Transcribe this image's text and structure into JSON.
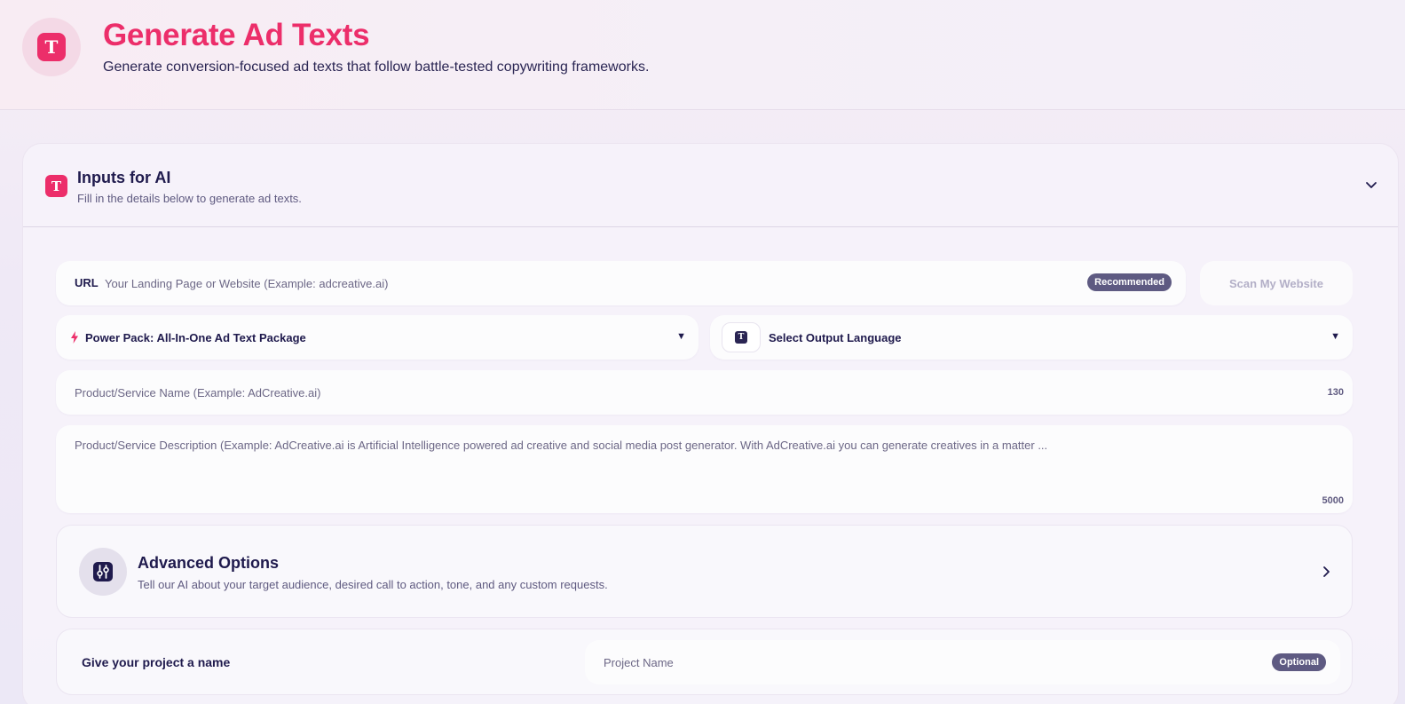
{
  "header": {
    "title": "Generate Ad Texts",
    "subtitle": "Generate conversion-focused ad texts that follow battle-tested copywriting frameworks.",
    "logo_icon": "t-logo-icon"
  },
  "inputs_card": {
    "title": "Inputs for AI",
    "subtitle": "Fill in the details below to generate ad texts.",
    "collapse_icon": "chevron-down-icon"
  },
  "url_field": {
    "label": "URL",
    "value": "",
    "placeholder": "Your Landing Page or Website (Example: adcreative.ai)",
    "badge": "Recommended"
  },
  "scan_button": {
    "label": "Scan My Website"
  },
  "package_select": {
    "icon": "lightning-bolt-icon",
    "selected": "Power Pack: All-In-One Ad Text Package"
  },
  "language_select": {
    "icon": "translate-icon",
    "selected": "Select Output Language"
  },
  "product_name": {
    "value": "",
    "placeholder": "Product/Service Name (Example: AdCreative.ai)",
    "char_limit": "130"
  },
  "product_description": {
    "value": "",
    "placeholder": "Product/Service Description (Example: AdCreative.ai is Artificial Intelligence powered ad creative and social media post generator. With AdCreative.ai you can generate creatives in a matter ...",
    "char_limit": "5000"
  },
  "advanced_options": {
    "title": "Advanced Options",
    "subtitle": "Tell our AI about your target audience, desired call to action, tone, and any custom requests.",
    "icon": "sliders-icon"
  },
  "project": {
    "label": "Give your project a name",
    "value": "",
    "placeholder": "Project Name",
    "badge": "Optional"
  },
  "colors": {
    "brand_pink": "#ec2e6a",
    "navy_text": "#1f1a4d",
    "badge_bg": "#5e5a82"
  }
}
